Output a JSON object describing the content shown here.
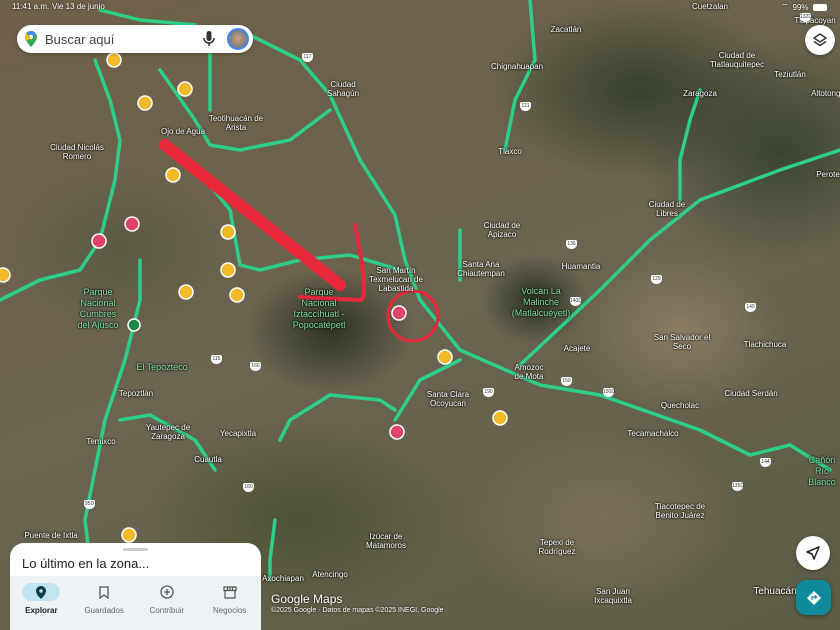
{
  "status_bar": {
    "time": "11:41 a.m.",
    "date": "Vie 13 de junio",
    "battery": "99%"
  },
  "search": {
    "placeholder": "Buscar aquí"
  },
  "places": [
    "Cuetzalan",
    "Zacatlán",
    "Chignahuapan",
    "Tlaxco",
    "Ciudad Sahagún",
    "Teotihuacán de Arista",
    "Ojo de Agua",
    "Ciudad Nicolás Romero",
    "Ciudad de Tlatlauquitepec",
    "Teziutlán",
    "Zaragoza",
    "Altotonga",
    "Perote",
    "Ciudad de Libres",
    "Ciudad de Apizaco",
    "Huamantla",
    "Santa Ana Chiautempan",
    "San Martín Texmelucan de Labastida",
    "Acajete",
    "San Salvador el Seco",
    "Tlachichuca",
    "Amozoc de Mota",
    "Santa Clara Ocoyucan",
    "Quecholac",
    "Ciudad Serdán",
    "Yautepec de Zaragoza",
    "Temixco",
    "Yecapixtla",
    "Cuautla",
    "Tecamachalco",
    "Tlacotepec de Benito Juárez",
    "Puente de Ixtla",
    "Izúcar de Matamoros",
    "Tepexi de Rodríguez",
    "Axochiapan",
    "Atencingo",
    "San Juan Ixcaquixtla",
    "Tehuacán",
    "Tepoztlán",
    "Tlapacoyan"
  ],
  "parks": [
    "Volcán La Malinche (Matlalcuéyetl)",
    "Parque Nacional Iztaccíhuatl - Popocatépetl",
    "Parque Nacional Cumbres del Ajusco",
    "El Tepozteco",
    "Cañón Río Blanco"
  ],
  "highway_shields": [
    "132D",
    "150D",
    "140D",
    "136",
    "150",
    "190",
    "115",
    "160",
    "144",
    "135D",
    "95D",
    "160",
    "117",
    "121",
    "129",
    "140"
  ],
  "sheet": {
    "title": "Lo último en la zona...",
    "tabs": [
      {
        "label": "Explorar",
        "active": true
      },
      {
        "label": "Guardados"
      },
      {
        "label": "Contribuir"
      },
      {
        "label": "Negocios"
      }
    ]
  },
  "attribution": {
    "logo": "Google Maps",
    "text": "©2025 Google · Datos de mapas ©2025 INEGI, Google"
  },
  "colors": {
    "road": "#2ecf8a",
    "annotation": "#e8283a",
    "favorite": "#e0436b",
    "star": "#f2b92b"
  }
}
